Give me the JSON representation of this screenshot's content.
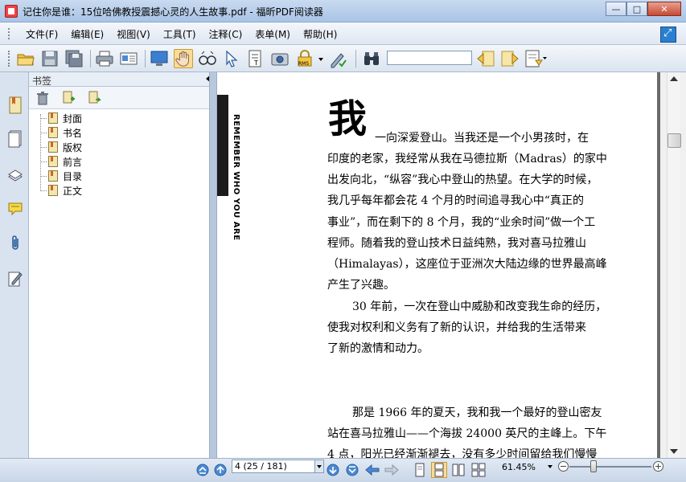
{
  "window": {
    "title": "记住你是谁：15位哈佛教授震撼心灵的人生故事.pdf - 福昕PDF阅读器",
    "minimize": "—",
    "maximize": "□",
    "close": "✕"
  },
  "menu": {
    "items": [
      "文件(F)",
      "编辑(E)",
      "视图(V)",
      "工具(T)",
      "注释(C)",
      "表单(M)",
      "帮助(H)"
    ]
  },
  "toolbar": {
    "find_value": ""
  },
  "bookmark_panel": {
    "title": "书签",
    "items": [
      "封面",
      "书名",
      "版权",
      "前言",
      "目录",
      "正文"
    ]
  },
  "document": {
    "side_title": "REMEMBER",
    "side_subtitle": "WHO YOU ARE",
    "dropcap": "我",
    "lines": [
      "一向深爱登山。当我还是一个小男孩时，在",
      "印度的老家，我经常从我在马德拉斯（Madras）的家中",
      "出发向北，“纵容”我心中登山的热望。在大学的时候，",
      "我几乎每年都会花 4 个月的时间追寻我心中“真正的",
      "事业”，而在剩下的 8 个月，我的“业余时间”做一个工",
      "程师。随着我的登山技术日益纯熟，我对喜马拉雅山",
      "（Himalayas），这座位于亚洲次大陆边缘的世界最高峰",
      "产生了兴趣。",
      "30 年前，一次在登山中威胁和改变我生命的经历，",
      "使我对权利和义务有了新的认识，并给我的生活带来",
      "了新的激情和动力。",
      "那是 1966 年的夏天，我和我一个最好的登山密友",
      "站在喜马拉雅山——个海拔 24000 英尺的主峰上。下午",
      "4 点，阳光已经渐渐褪去，没有多少时间留给我们慢慢"
    ]
  },
  "statusbar": {
    "page_field": "4 (25 / 181)",
    "zoom": "61.45%",
    "zoom_minus": "−",
    "zoom_plus": "+"
  }
}
